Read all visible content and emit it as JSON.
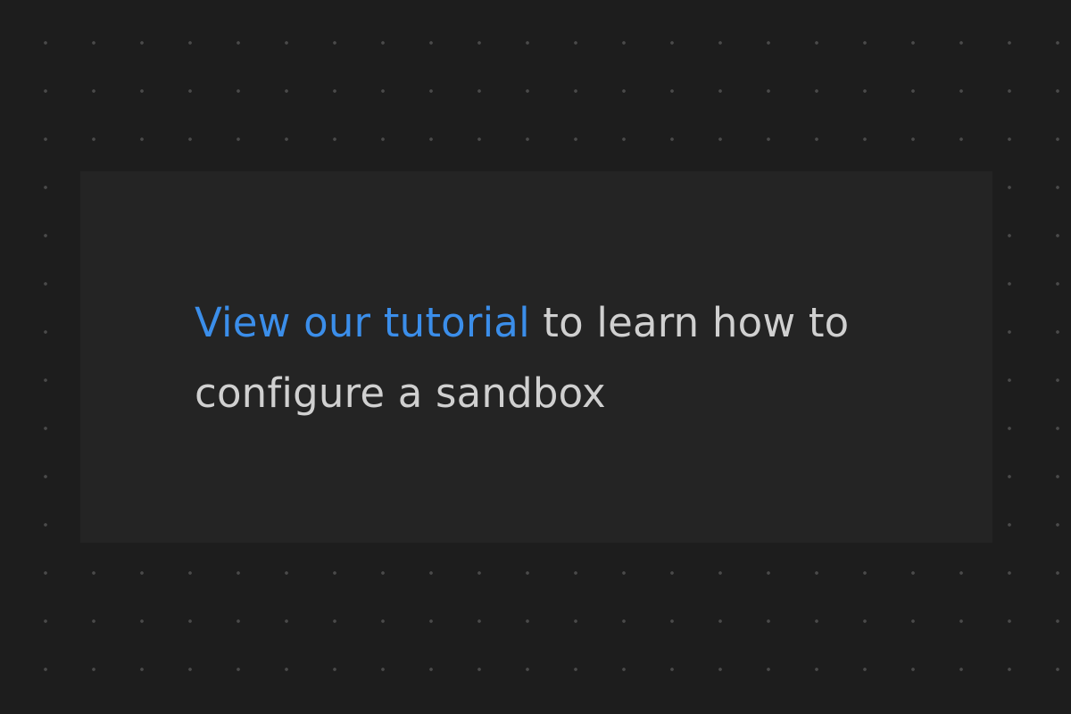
{
  "empty_state": {
    "link_text": "View our tutorial",
    "message_rest": " to learn how to configure a sandbox"
  },
  "colors": {
    "background": "#1d1d1d",
    "card": "#242424",
    "link": "#3b8eea",
    "text": "#d0d0d0",
    "dot": "#4a4a4a"
  }
}
